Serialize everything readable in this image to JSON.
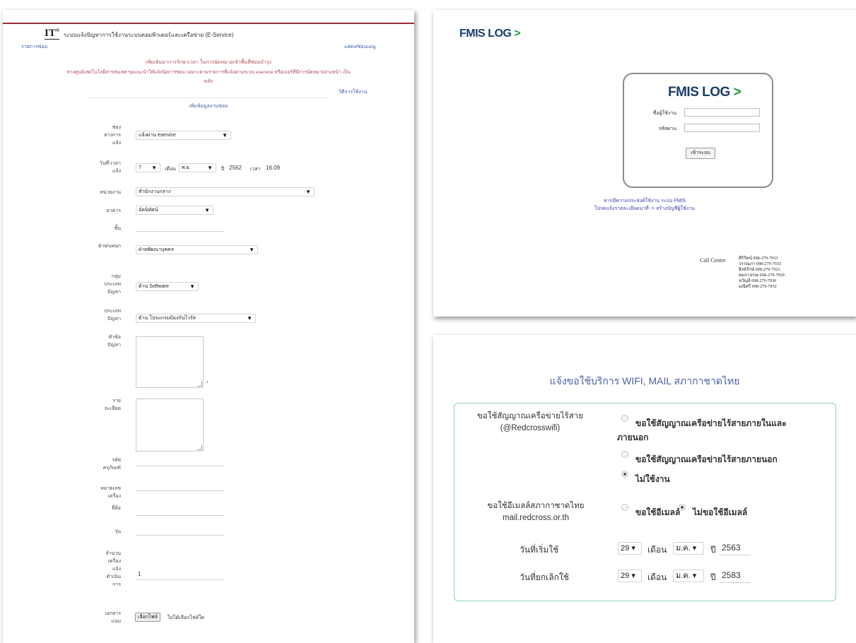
{
  "eservice": {
    "logo": "IT",
    "title": "ระบบแจ้งปัญหาการใช้งานระบบคอมพิวเตอร์และเครือข่าย (E-Service)",
    "nav_left": "รายการซ่อม",
    "nav_right": "แสดง/ซ่อนเมนู",
    "notice_lines": [
      "เพิ่มเติมมาการรักษาเวลา ในการนัดหมายเข้าพื้นที่ซ่อมบำรุง",
      "ทางศูนย์เทคโนโลยีสารสนเทศ ขอแนะนำให้แจ้งนัดการซ่อม เฉพาะตามรายการที่แจ้งผ่านระบบ eservice หรือเบอร์ที่มีการนัดหมายล่วงหน้า เป็น",
      "หลัก"
    ],
    "manual_link": "วิธีการใช้งาน",
    "section_title": "เพิ่มข้อมูลงานซ่อม",
    "fields": {
      "channel": {
        "label": "ช่องทางการแจ้ง",
        "value": "แจ้งผ่าน eservice"
      },
      "datetime": {
        "label": "วันที่-เวลาแจ้ง",
        "day": "7",
        "month_label": "เดือน",
        "month": "พ.ย.",
        "year_label": "ปี",
        "year": "2562",
        "time_label": "เวลา",
        "time": "16.09"
      },
      "department": {
        "label": "หน่วยงาน",
        "value": "สำนักงานกลาง"
      },
      "building": {
        "label": "อาคาร",
        "value": "อัคนิทัศน์"
      },
      "floor": {
        "label": "ชั้น"
      },
      "division": {
        "label": "ฝ่าย/แผนก",
        "value": "ฝ่ายพัฒนาบุคคล"
      },
      "problem_group": {
        "label": "กลุ่มประเภทปัญหา",
        "value": "ด้าน Software"
      },
      "problem_type": {
        "label": "ประเภทปัญหา",
        "value": "ด้าน โปรแกรมป้องกันไวรัส"
      },
      "subject": {
        "label": "หัวข้อปัญหา",
        "required_mark": "*"
      },
      "details": {
        "label": "รายละเอียด"
      },
      "asset_code": {
        "label": "รหัสครุภัณฑ์"
      },
      "serial": {
        "label": "หมายเลขเครื่อง"
      },
      "brand": {
        "label": "ยี่ห้อ"
      },
      "model": {
        "label": "รุ่น"
      },
      "count": {
        "label": "จำนวนเครื่องแจ้งดำเนินการ",
        "value": "1"
      },
      "attachment": {
        "label": "เอกสารแนบ",
        "button": "เลือกไฟล์",
        "status": "ไม่ได้เลือกไฟล์ใด"
      }
    }
  },
  "fmis": {
    "logo_text": "FMIS LOG",
    "logo_chevron": ">",
    "username_label": "ชื่อผู้ใช้งาน",
    "password_label": "รหัสผ่าน",
    "login_button": "เข้าระบบ",
    "note_line1": "หากมีความประสงค์ใช้งาน ระบบ FMIS",
    "note_line2": "โปรดแจ้งรายละเอียดมาที่ -> สร้างบัญชีผู้ใช้งาน",
    "call_center_label": "Call Center",
    "call_center_lines": [
      "ศิริรัตน์ 098-279-7933",
      "วรรณภา 098-279-7933",
      "สิงห์รักษ์ 098-279-7921",
      "คมกาจรณ 098-279-7929",
      "ขวัญจิ 098-279-7930",
      "มณีศรี 098-279-7932"
    ],
    "colors": {
      "navy": "#1a3d6d",
      "green": "#1e9c3c"
    }
  },
  "wifi_form": {
    "title": "แจ้งขอใช้บริการ WIFI, MAIL สภากาชาดไทย",
    "wifi_label_line1": "ขอใช้สัญญาณเครือข่ายไร้สาย",
    "wifi_label_line2": "(@Redcrosswifi)",
    "wifi_options": [
      {
        "label_line1": "ขอใช้สัญญาณเครือข่ายไร้สายภายในและ",
        "label_line2": "ภายนอก",
        "selected": false
      },
      {
        "label_line1": "ขอใช้สัญญาณเครือข่ายไร้สายภายนอก",
        "selected": false
      },
      {
        "label_line1": "ไม่ใช้งาน",
        "selected": true
      }
    ],
    "mail_label_line1": "ขอใช้อีเมลล์สภากาชาดไทย",
    "mail_label_line2": "mail.redcross.or.th",
    "mail_options": [
      {
        "label": "ขอใช้อีเมลล์",
        "selected": false
      },
      {
        "label": "ไม่ขอใช้อีเมลล์",
        "selected": true
      }
    ],
    "start": {
      "label": "วันที่เริ่มใช้",
      "day": "29",
      "month_label": "เดือน",
      "month": "ม.ค.",
      "year_label": "ปี",
      "year": "2563"
    },
    "end": {
      "label": "วันที่ยกเลิกใช้",
      "day": "29",
      "month_label": "เดือน",
      "month": "ม.ค.",
      "year_label": "ปี",
      "year": "2583"
    },
    "dropdown_arrow": "▾",
    "colors": {
      "title": "#4b5fa3",
      "border": "#8fd2b6"
    }
  }
}
